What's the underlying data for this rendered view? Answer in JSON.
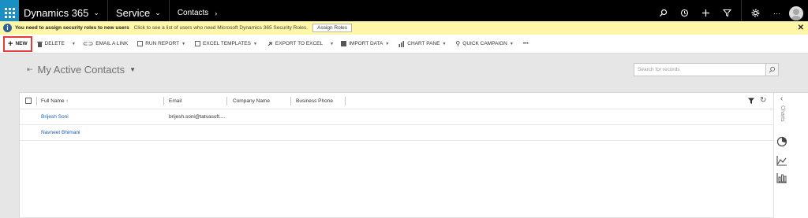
{
  "topnav": {
    "app_title": "Dynamics 365",
    "area": "Service",
    "breadcrumb": "Contacts",
    "icons": [
      "search-icon",
      "history-icon",
      "plus-icon",
      "filter-icon",
      "settings-icon",
      "more-icon",
      "avatar"
    ]
  },
  "notification": {
    "bold_text": "You need to assign security roles to new users",
    "link_text": "Click to see a list of users who need Microsoft Dynamics 365 Security Roles.",
    "button": "Assign Roles",
    "close": "✕"
  },
  "commandbar": {
    "new": "NEW",
    "delete": "DELETE",
    "email_link": "EMAIL A LINK",
    "run_report": "RUN REPORT",
    "excel_templates": "EXCEL TEMPLATES",
    "export_excel": "EXPORT TO EXCEL",
    "import_data": "IMPORT DATA",
    "chart_pane": "CHART PANE",
    "quick_campaign": "QUICK CAMPAIGN",
    "more": "•••"
  },
  "view": {
    "title": "My Active Contacts",
    "search_placeholder": "Search for records"
  },
  "grid": {
    "columns": [
      "Full Name ↑",
      "Email",
      "Company Name",
      "Business Phone"
    ],
    "rows": [
      {
        "full_name": "Brijesh Soni",
        "email": "brijesh.soni@tatvasoft...."
      },
      {
        "full_name": "Navneet Bhimani",
        "email": ""
      }
    ]
  },
  "sidepane": {
    "label": "Charts"
  },
  "colors": {
    "accent": "#1a8fc4",
    "notification_bg": "#fff7a8",
    "highlight": "#e53b3b",
    "link": "#1a5fb4"
  }
}
